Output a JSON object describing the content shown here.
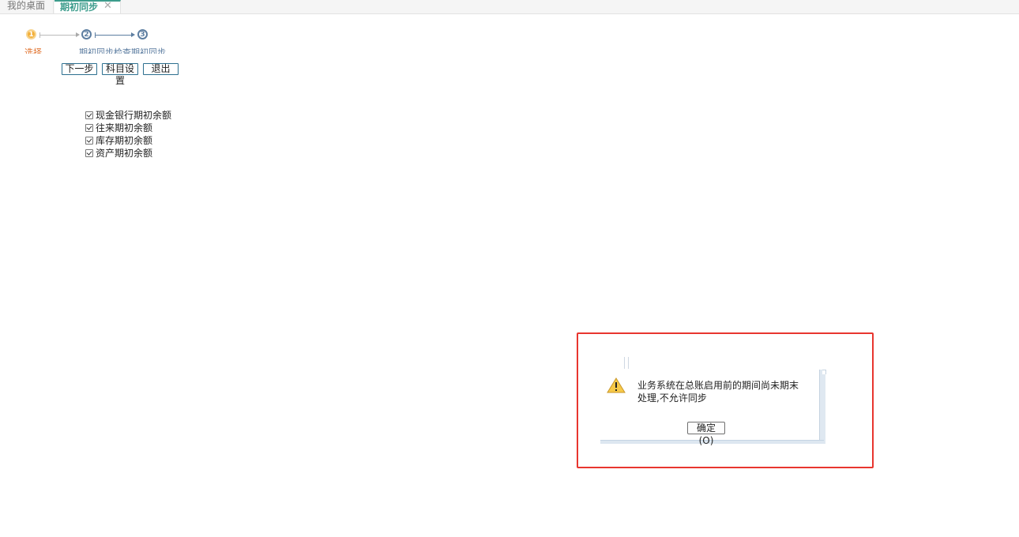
{
  "tabs": {
    "desktop_label": "我的桌面",
    "active_label": "期初同步",
    "close_glyph": "✕"
  },
  "steps": {
    "numbers": [
      "1",
      "2",
      "3"
    ],
    "label_1": "选择",
    "label_2": "期初同步检查期初同步"
  },
  "buttons": {
    "next": "下一步",
    "subject_settings": "科目设置",
    "exit": "退出"
  },
  "options": [
    "现金银行期初余额",
    "往来期初余额",
    "库存期初余额",
    "资产期初余额"
  ],
  "dialog": {
    "icon": "warning-icon",
    "message": "业务系统在总账启用前的期间尚未期末处理,不允许同步",
    "ok_label": "确定",
    "ok_shortcut": "(O)"
  },
  "colors": {
    "accent": "#3c9c8c",
    "highlight": "#e8362f",
    "step_active": "#f3b03a",
    "step_pending": "#5d7ea1"
  }
}
